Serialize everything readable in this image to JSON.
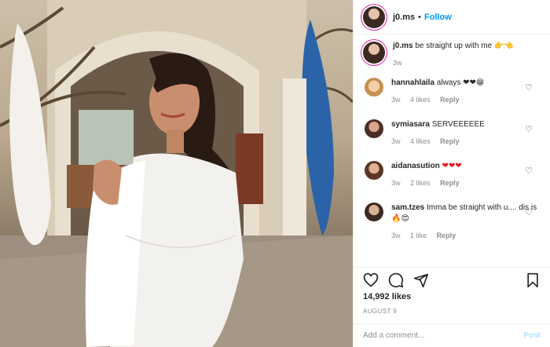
{
  "header": {
    "username": "j0.ms",
    "separator": "•",
    "follow_label": "Follow"
  },
  "caption": {
    "username": "j0.ms",
    "text": "be straight up with me 👉👈",
    "time": "3w"
  },
  "comments": [
    {
      "username": "hannahlaila",
      "text": "always ❤❤😁",
      "time": "3w",
      "likes": "4 likes",
      "reply": "Reply",
      "avatar_color": "#d9a56b"
    },
    {
      "username": "symiasara",
      "text": "SERVEEEEEE",
      "time": "3w",
      "likes": "4 likes",
      "reply": "Reply",
      "avatar_color": "#6e4a3f"
    },
    {
      "username": "aidanasution",
      "text": "❤❤❤",
      "time": "3w",
      "likes": "2 likes",
      "reply": "Reply",
      "avatar_color": "#8a5a48"
    },
    {
      "username": "sam.tzes",
      "text": "Imma be straight with u.... dis is 🔥😍",
      "time": "3w",
      "likes": "1 like",
      "reply": "Reply",
      "avatar_color": "#5a4a40"
    }
  ],
  "icons": {
    "like": "heart-icon",
    "comment": "comment-icon",
    "share": "share-icon",
    "save": "bookmark-icon"
  },
  "likes_count": "14,992 likes",
  "date": "AUGUST 9",
  "add_comment": {
    "placeholder": "Add a comment...",
    "post_label": "Post"
  },
  "colors": {
    "link": "#0095f6",
    "muted": "#8e8e8e",
    "text": "#262626",
    "post_disabled": "#b2dffc"
  }
}
